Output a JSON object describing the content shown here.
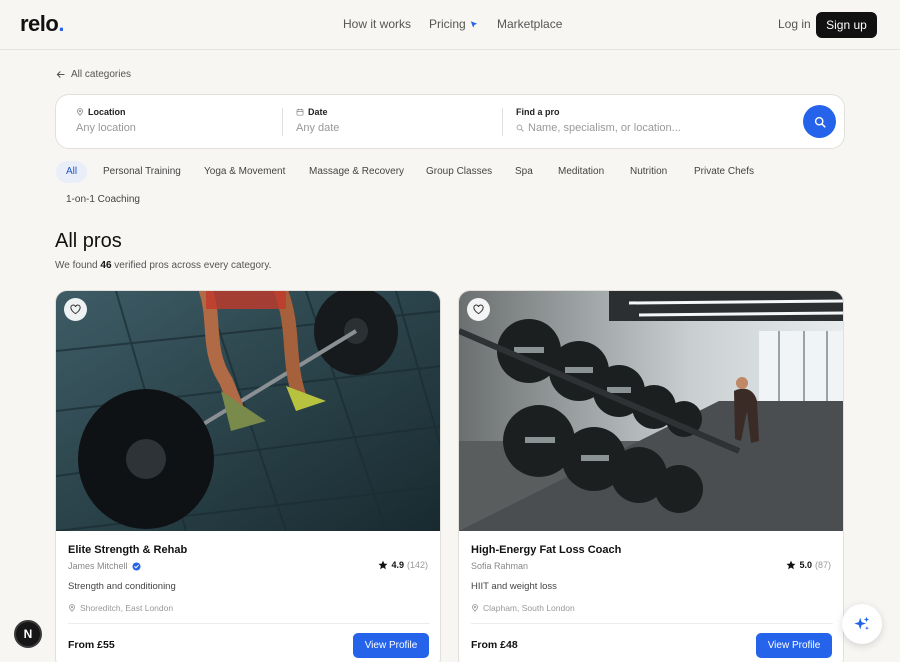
{
  "header": {
    "logo_text": "relo",
    "logo_dot": ".",
    "nav": [
      "How it works",
      "Pricing",
      "Marketplace"
    ],
    "login_label": "Log in",
    "signup_label": "Sign up"
  },
  "back_link": "All categories",
  "search": {
    "location_label": "Location",
    "location_value": "Any location",
    "date_label": "Date",
    "date_value": "Any date",
    "pro_label": "Find a pro",
    "pro_placeholder": "Name, specialism, or location..."
  },
  "categories": [
    "All",
    "Personal Training",
    "Yoga & Movement",
    "Massage & Recovery",
    "Group Classes",
    "Spa",
    "Meditation",
    "Nutrition",
    "Private Chefs",
    "1-on-1 Coaching"
  ],
  "active_category": "All",
  "results": {
    "title": "All pros",
    "summary_prefix": "We found ",
    "count": "46",
    "summary_suffix": " verified pros across every category."
  },
  "cards": [
    {
      "name": "Elite Strength & Rehab",
      "pro": "James Mitchell",
      "verified": true,
      "rating": "4.9",
      "reviews": "(142)",
      "specialism": "Strength and conditioning",
      "location": "Shoreditch, East London",
      "price": "From £55",
      "button": "View Profile"
    },
    {
      "name": "High-Energy Fat Loss Coach",
      "pro": "Sofia Rahman",
      "verified": false,
      "rating": "5.0",
      "reviews": "(87)",
      "specialism": "HIIT and weight loss",
      "location": "Clapham, South London",
      "price": "From £48",
      "button": "View Profile"
    }
  ],
  "badge_letter": "N",
  "colors": {
    "accent": "#2563eb",
    "background": "#f7f6f3",
    "dark": "#111111"
  }
}
